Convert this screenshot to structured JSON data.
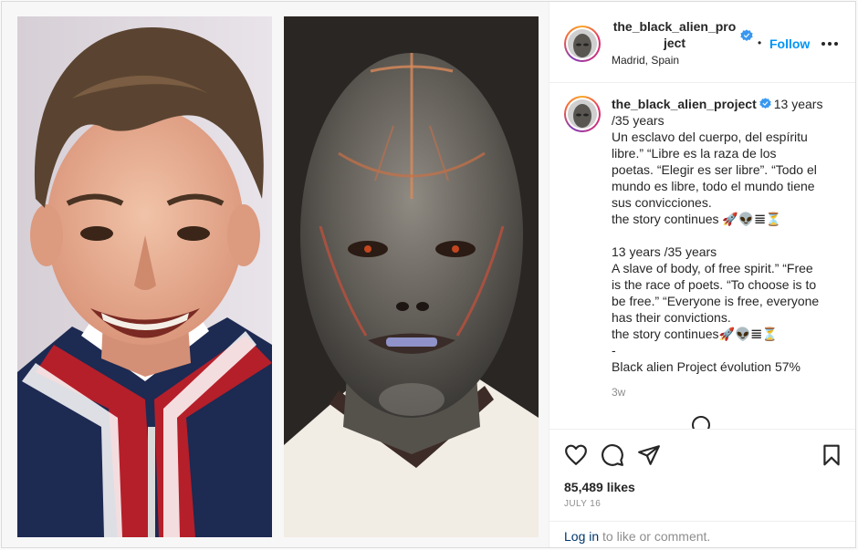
{
  "post": {
    "username_header": "the_black_alien_project",
    "location": "Madrid, Spain",
    "follow_dot": "•",
    "follow_label": "Follow",
    "more_label": "More options"
  },
  "caption": {
    "username": "the_black_alien_project",
    "lines": [
      "13 years",
      "/35 years",
      "Un esclavo del cuerpo, del espíritu",
      "libre.” “Libre es la raza de los",
      "poetas. “Elegir es ser libre”. “Todo el",
      "mundo es libre, todo el mundo tiene",
      "sus convicciones.",
      "the story continues 🚀👽𝌆⏳",
      "",
      "13 years /35 years",
      "A slave of body, of free spirit.” “Free",
      "is the race of poets. “To choose is to",
      "be free.” “Everyone is free, everyone",
      "has their convictions.",
      "the story continues🚀👽𝌆⏳",
      "-",
      "Black alien Project évolution 57%"
    ],
    "time_ago": "3w"
  },
  "engagement": {
    "likes": "85,489 likes",
    "date": "JULY 16",
    "login_link": "Log in",
    "login_rest": " to like or comment."
  },
  "icons": {
    "like": "heart-icon",
    "comment": "comment-icon",
    "share": "share-icon",
    "save": "bookmark-icon",
    "verified": "verified-badge-icon",
    "more": "more-dots-icon"
  },
  "colors": {
    "accent": "#0095f6",
    "verified": "#3897f0",
    "muted": "#8e8e8e",
    "text": "#262626"
  }
}
